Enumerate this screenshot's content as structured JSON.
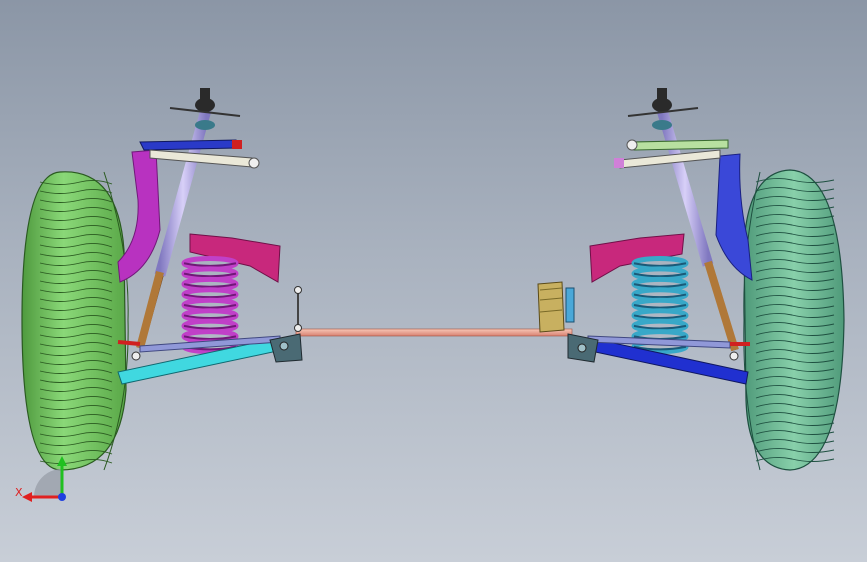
{
  "viewport": {
    "background_top": "#8b96a6",
    "background_bottom": "#c8ced7"
  },
  "triad": {
    "x_label": "X",
    "x_color": "#e02020",
    "y_color": "#20c020",
    "z_color": "#2040e0"
  },
  "model": {
    "tire_color": "#7fd06a",
    "tire_right_color": "#6fbe98",
    "spring_left_color": "#c040c8",
    "spring_right_color": "#38a8c8",
    "tie_rod_color": "#f0a890",
    "strut_color": "#b0a8e0",
    "left_lower_arm_color": "#40d8e0",
    "right_lower_arm_color": "#2030d0",
    "left_knuckle_color": "#b030b8",
    "right_knuckle_color": "#3040c8",
    "steering_box_color": "#c8b060"
  }
}
